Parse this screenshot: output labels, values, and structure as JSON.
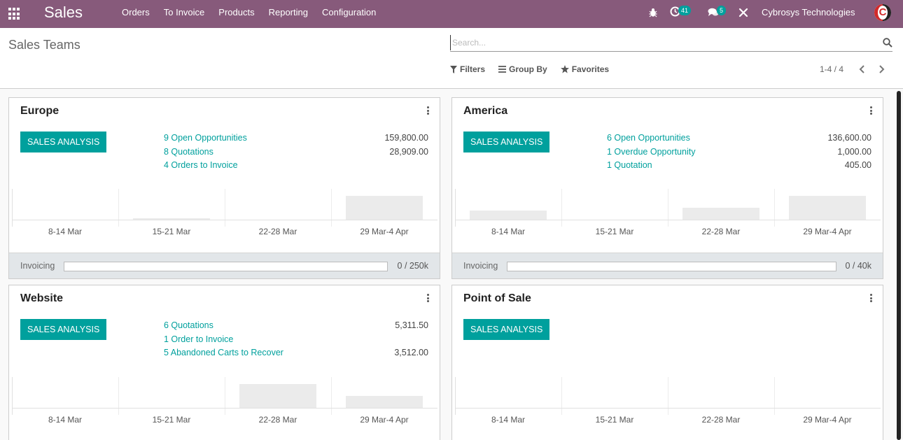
{
  "navbar": {
    "app_name": "Sales",
    "menu": [
      "Orders",
      "To Invoice",
      "Products",
      "Reporting",
      "Configuration"
    ],
    "activity_count": "41",
    "message_count": "5",
    "company": "Cybrosys Technologies"
  },
  "control": {
    "title": "Sales Teams",
    "search_placeholder": "Search...",
    "filters_label": "Filters",
    "groupby_label": "Group By",
    "favorites_label": "Favorites",
    "pager": "1-4 / 4"
  },
  "cards": [
    {
      "title": "Europe",
      "button": "SALES ANALYSIS",
      "links": [
        {
          "label": "9 Open Opportunities",
          "amount": "159,800.00"
        },
        {
          "label": "8 Quotations",
          "amount": "28,909.00"
        },
        {
          "label": "4 Orders to Invoice",
          "amount": ""
        }
      ],
      "weeks": [
        "8-14 Mar",
        "15-21 Mar",
        "22-28 Mar",
        "29 Mar-4 Apr"
      ],
      "bar_levels": [
        0,
        0.06,
        0,
        1.0
      ],
      "invoicing_label": "Invoicing",
      "invoicing_progress": 0,
      "invoicing_text": "0 / 250k"
    },
    {
      "title": "America",
      "button": "SALES ANALYSIS",
      "links": [
        {
          "label": "6 Open Opportunities",
          "amount": "136,600.00"
        },
        {
          "label": "1 Overdue Opportunity",
          "amount": "1,000.00"
        },
        {
          "label": "1 Quotation",
          "amount": "405.00"
        }
      ],
      "weeks": [
        "8-14 Mar",
        "15-21 Mar",
        "22-28 Mar",
        "29 Mar-4 Apr"
      ],
      "bar_levels": [
        0.37,
        0,
        0.5,
        1.0
      ],
      "invoicing_label": "Invoicing",
      "invoicing_progress": 0,
      "invoicing_text": "0 / 40k"
    },
    {
      "title": "Website",
      "button": "SALES ANALYSIS",
      "links": [
        {
          "label": "6 Quotations",
          "amount": "5,311.50"
        },
        {
          "label": "1 Order to Invoice",
          "amount": ""
        },
        {
          "label": "5 Abandoned Carts to Recover",
          "amount": "3,512.00"
        }
      ],
      "weeks": [
        "8-14 Mar",
        "15-21 Mar",
        "22-28 Mar",
        "29 Mar-4 Apr"
      ],
      "bar_levels": [
        0,
        0,
        1.0,
        0.5
      ]
    },
    {
      "title": "Point of Sale",
      "button": "SALES ANALYSIS",
      "links": [],
      "weeks": [
        "8-14 Mar",
        "15-21 Mar",
        "22-28 Mar",
        "29 Mar-4 Apr"
      ],
      "bar_levels": [
        0,
        0,
        0,
        0
      ]
    }
  ],
  "colors": {
    "navbar": "#875a7b",
    "accent": "#00a09d"
  }
}
